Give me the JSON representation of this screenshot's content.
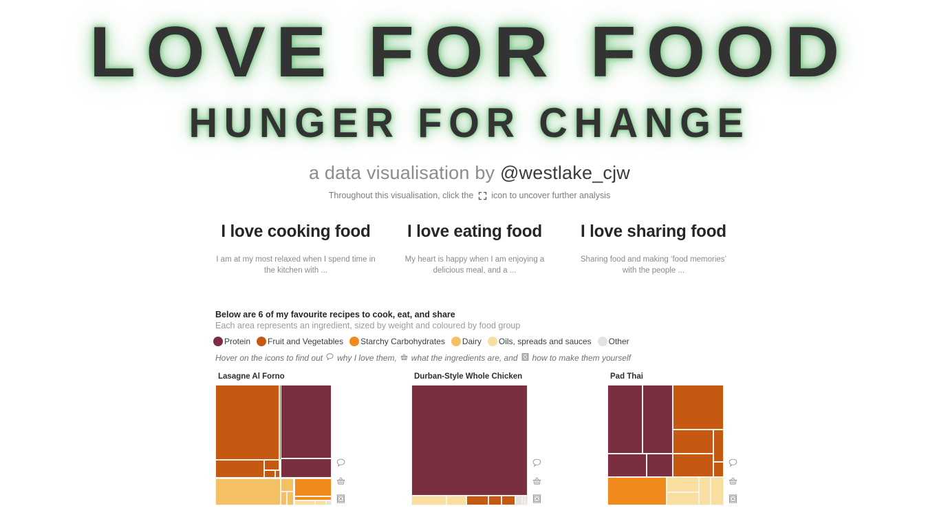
{
  "hero": {
    "title_main": "LOVE FOR FOOD",
    "title_sub": "HUNGER FOR CHANGE",
    "byline_prefix": "a data visualisation by ",
    "byline_handle": "@westlake_cjw",
    "hint_prefix": "Throughout this visualisation, click the ",
    "hint_suffix": " icon to uncover further analysis",
    "hint_icon": "expand-icon",
    "glow_color": "#6ebe78",
    "title_color": "#333333"
  },
  "columns": [
    {
      "heading": "I love cooking food",
      "body": "I am at my most relaxed when I spend time in the kitchen with ..."
    },
    {
      "heading": "I love eating food",
      "body": "My heart is happy when I am enjoying a delicious meal, and a ..."
    },
    {
      "heading": "I love sharing food",
      "body": "Sharing food and making ‘food memories’ with the people ..."
    }
  ],
  "intro": {
    "title": "Below are 6 of my favourite recipes to cook, eat, and share",
    "subtitle": "Each area represents an ingredient, sized by weight and coloured by food group"
  },
  "legend": [
    {
      "label": "Protein",
      "color": "#7b2e40"
    },
    {
      "label": "Fruit and Vegetables",
      "color": "#c65911"
    },
    {
      "label": "Starchy Carbohydrates",
      "color": "#f08a1c"
    },
    {
      "label": "Dairy",
      "color": "#f3c064"
    },
    {
      "label": "Oils, spreads and sauces",
      "color": "#f8dfa0"
    },
    {
      "label": "Other",
      "color": "#e3e3e3"
    }
  ],
  "hover_hint": {
    "part1": "Hover on the icons to find out ",
    "icon1": "speech-bubble-icon",
    "part2": " why I love them, ",
    "icon2": "basket-icon",
    "part3": " what the ingredients are, and ",
    "icon3": "recipe-card-icon",
    "part4": " how to make them yourself"
  },
  "chart_data": [
    {
      "type": "treemap",
      "title": "Lasagne Al Forno",
      "tiles": [
        {
          "group": "Fruit and Vegetables",
          "color": "#c65911",
          "x": 0,
          "y": 0,
          "w": 55.0,
          "h": 62.0
        },
        {
          "group": "Fruit and Vegetables",
          "color": "#c65911",
          "x": 55.0,
          "y": 0,
          "w": 44.5,
          "h": 62.0
        },
        {
          "group": "Fruit and Vegetables",
          "color": "#c65911",
          "x": 0,
          "y": 62.0,
          "w": 42.0,
          "h": 15.0
        },
        {
          "group": "Fruit and Vegetables",
          "color": "#c65911",
          "x": 42.0,
          "y": 62.0,
          "w": 13.0,
          "h": 9.0
        },
        {
          "group": "Fruit and Vegetables",
          "color": "#c65911",
          "x": 42.0,
          "y": 71.0,
          "w": 9.5,
          "h": 6.0
        },
        {
          "group": "Fruit and Vegetables",
          "color": "#c65911",
          "x": 51.5,
          "y": 71.0,
          "w": 4.0,
          "h": 6.0
        },
        {
          "group": "Protein",
          "color": "#7b2e40",
          "x": 56.0,
          "y": 0,
          "w": 44.0,
          "h": 61.0
        },
        {
          "group": "Protein",
          "color": "#7b2e40",
          "x": 56.0,
          "y": 61.0,
          "w": 44.0,
          "h": 16.0
        },
        {
          "group": "Dairy",
          "color": "#f3c064",
          "x": 0,
          "y": 77.5,
          "w": 56.0,
          "h": 22.5
        },
        {
          "group": "Dairy",
          "color": "#f3c064",
          "x": 56.0,
          "y": 77.5,
          "w": 11.5,
          "h": 11.0
        },
        {
          "group": "Dairy",
          "color": "#f3c064",
          "x": 56.0,
          "y": 88.5,
          "w": 5.5,
          "h": 11.5
        },
        {
          "group": "Dairy",
          "color": "#f3c064",
          "x": 61.5,
          "y": 88.5,
          "w": 6.0,
          "h": 11.5
        },
        {
          "group": "Starchy Carbohydrates",
          "color": "#f08a1c",
          "x": 68.0,
          "y": 77.5,
          "w": 32.0,
          "h": 15.0
        },
        {
          "group": "Starchy Carbohydrates",
          "color": "#f08a1c",
          "x": 68.0,
          "y": 92.5,
          "w": 32.0,
          "h": 3.5
        },
        {
          "group": "Oils, spreads and sauces",
          "color": "#f8dfa0",
          "x": 68.0,
          "y": 96.0,
          "w": 18.0,
          "h": 4.0
        },
        {
          "group": "Oils, spreads and sauces",
          "color": "#f8dfa0",
          "x": 86.0,
          "y": 96.0,
          "w": 9.0,
          "h": 4.0
        },
        {
          "group": "Other",
          "color": "#e3e3e3",
          "x": 95.0,
          "y": 96.0,
          "w": 5.0,
          "h": 4.0
        }
      ]
    },
    {
      "type": "treemap",
      "title": "Durban-Style Whole Chicken",
      "tiles": [
        {
          "group": "Protein",
          "color": "#7b2e40",
          "x": 0,
          "y": 0,
          "w": 100.0,
          "h": 92.0
        },
        {
          "group": "Oils, spreads and sauces",
          "color": "#f8dfa0",
          "x": 0,
          "y": 92.0,
          "w": 30.0,
          "h": 8.0
        },
        {
          "group": "Oils, spreads and sauces",
          "color": "#f8dfa0",
          "x": 30.0,
          "y": 92.0,
          "w": 17.5,
          "h": 8.0
        },
        {
          "group": "Fruit and Vegetables",
          "color": "#c65911",
          "x": 47.5,
          "y": 92.0,
          "w": 18.5,
          "h": 8.0
        },
        {
          "group": "Fruit and Vegetables",
          "color": "#c65911",
          "x": 66.0,
          "y": 92.0,
          "w": 11.5,
          "h": 8.0
        },
        {
          "group": "Fruit and Vegetables",
          "color": "#c65911",
          "x": 77.5,
          "y": 92.0,
          "w": 12.0,
          "h": 8.0
        },
        {
          "group": "Other",
          "color": "#e3e3e3",
          "x": 89.5,
          "y": 92.0,
          "w": 5.5,
          "h": 8.0
        },
        {
          "group": "Other",
          "color": "#e3e3e3",
          "x": 95.0,
          "y": 92.0,
          "w": 2.5,
          "h": 8.0
        },
        {
          "group": "Other",
          "color": "#e3e3e3",
          "x": 97.5,
          "y": 92.0,
          "w": 2.5,
          "h": 8.0
        }
      ]
    },
    {
      "type": "treemap",
      "title": "Pad Thai",
      "tiles": [
        {
          "group": "Protein",
          "color": "#7b2e40",
          "x": 0,
          "y": 0,
          "w": 30.0,
          "h": 57.0
        },
        {
          "group": "Protein",
          "color": "#7b2e40",
          "x": 30.0,
          "y": 0,
          "w": 26.0,
          "h": 57.0
        },
        {
          "group": "Protein",
          "color": "#7b2e40",
          "x": 0,
          "y": 57.0,
          "w": 34.0,
          "h": 19.5
        },
        {
          "group": "Protein",
          "color": "#7b2e40",
          "x": 34.0,
          "y": 57.0,
          "w": 22.0,
          "h": 19.5
        },
        {
          "group": "Fruit and Vegetables",
          "color": "#c65911",
          "x": 56.0,
          "y": 0,
          "w": 44.0,
          "h": 37.0
        },
        {
          "group": "Fruit and Vegetables",
          "color": "#c65911",
          "x": 56.0,
          "y": 37.0,
          "w": 35.0,
          "h": 20.0
        },
        {
          "group": "Fruit and Vegetables",
          "color": "#c65911",
          "x": 91.0,
          "y": 37.0,
          "w": 9.0,
          "h": 27.0
        },
        {
          "group": "Fruit and Vegetables",
          "color": "#c65911",
          "x": 56.0,
          "y": 57.0,
          "w": 35.0,
          "h": 19.5
        },
        {
          "group": "Fruit and Vegetables",
          "color": "#c65911",
          "x": 91.0,
          "y": 64.0,
          "w": 9.0,
          "h": 12.5
        },
        {
          "group": "Starchy Carbohydrates",
          "color": "#f08a1c",
          "x": 0,
          "y": 76.5,
          "w": 51.0,
          "h": 23.5
        },
        {
          "group": "Oils, spreads and sauces",
          "color": "#f8dfa0",
          "x": 51.0,
          "y": 76.5,
          "w": 27.5,
          "h": 12.5
        },
        {
          "group": "Oils, spreads and sauces",
          "color": "#f8dfa0",
          "x": 51.0,
          "y": 89.0,
          "w": 27.5,
          "h": 11.0
        },
        {
          "group": "Oils, spreads and sauces",
          "color": "#f8dfa0",
          "x": 78.5,
          "y": 76.5,
          "w": 10.5,
          "h": 23.5
        },
        {
          "group": "Oils, spreads and sauces",
          "color": "#f8dfa0",
          "x": 89.0,
          "y": 76.5,
          "w": 11.0,
          "h": 23.5
        }
      ]
    }
  ],
  "card_icons": [
    {
      "name": "speech-bubble-icon"
    },
    {
      "name": "basket-icon"
    },
    {
      "name": "recipe-card-icon"
    }
  ]
}
